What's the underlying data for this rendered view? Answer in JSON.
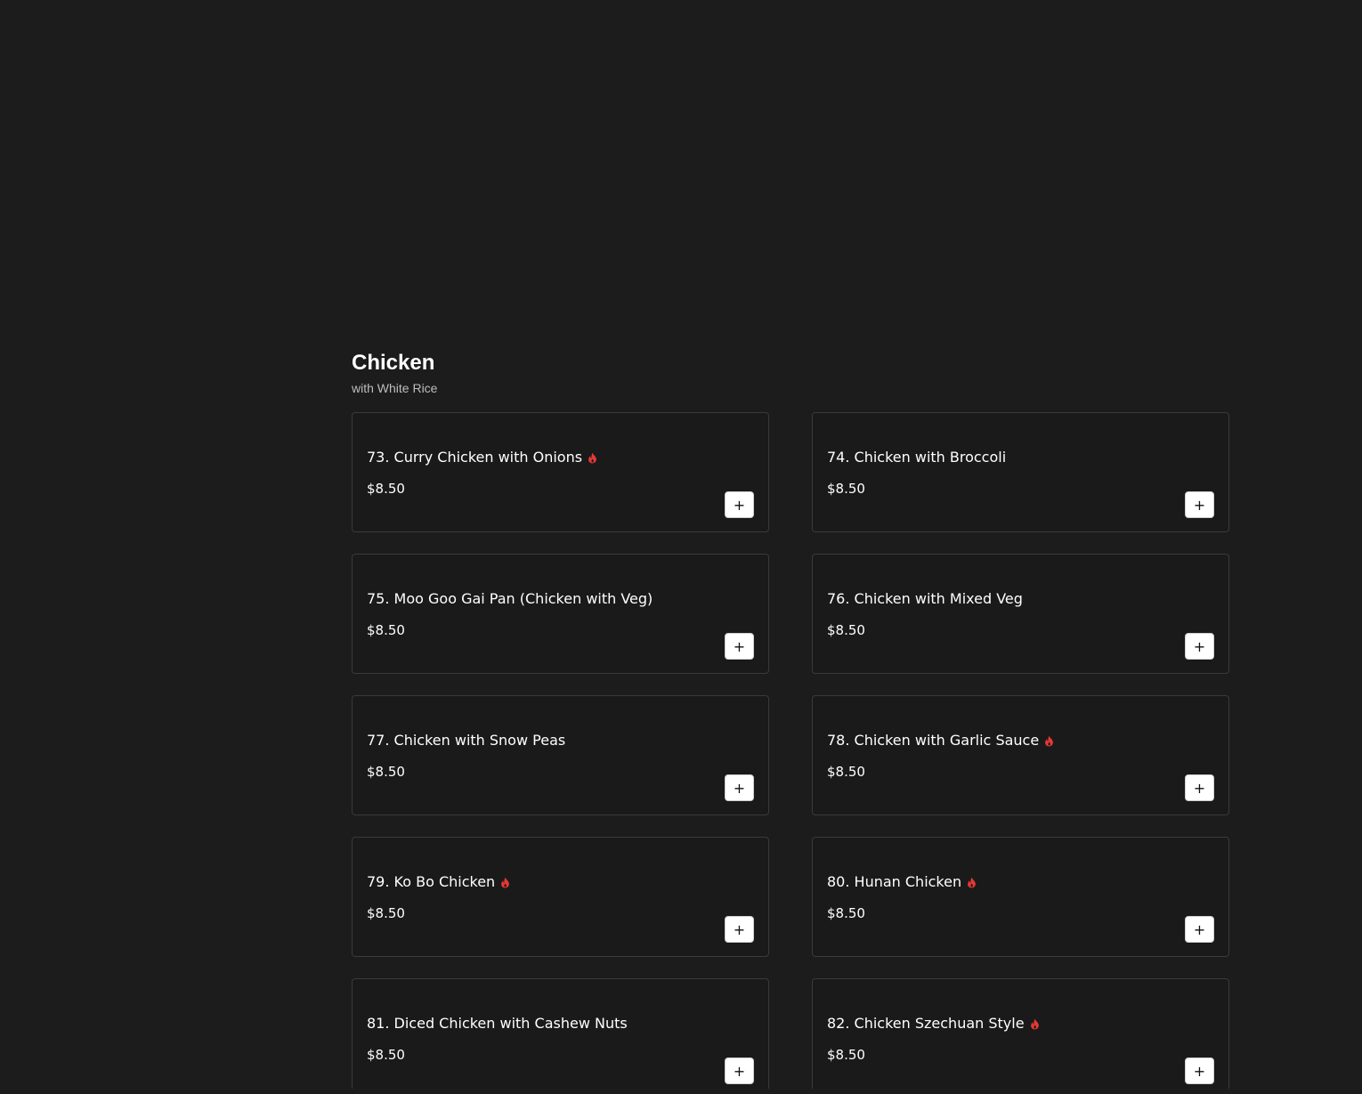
{
  "section": {
    "title": "Chicken",
    "subtitle": "with White Rice"
  },
  "colors": {
    "background": "#1c1c1c",
    "card_border": "#3a3a3a",
    "spicy": "#e53935"
  },
  "add_button_label": "+",
  "items": [
    {
      "name": "73. Curry Chicken with Onions",
      "price": "$8.50",
      "spicy": true
    },
    {
      "name": "74. Chicken with Broccoli",
      "price": "$8.50",
      "spicy": false
    },
    {
      "name": "75. Moo Goo Gai Pan (Chicken with Veg)",
      "price": "$8.50",
      "spicy": false
    },
    {
      "name": "76. Chicken with Mixed Veg",
      "price": "$8.50",
      "spicy": false
    },
    {
      "name": "77. Chicken with Snow Peas",
      "price": "$8.50",
      "spicy": false
    },
    {
      "name": "78. Chicken with Garlic Sauce",
      "price": "$8.50",
      "spicy": true
    },
    {
      "name": "79. Ko Bo Chicken",
      "price": "$8.50",
      "spicy": true
    },
    {
      "name": "80. Hunan Chicken",
      "price": "$8.50",
      "spicy": true
    },
    {
      "name": "81. Diced Chicken with Cashew Nuts",
      "price": "$8.50",
      "spicy": false
    },
    {
      "name": "82. Chicken Szechuan Style",
      "price": "$8.50",
      "spicy": true
    }
  ]
}
